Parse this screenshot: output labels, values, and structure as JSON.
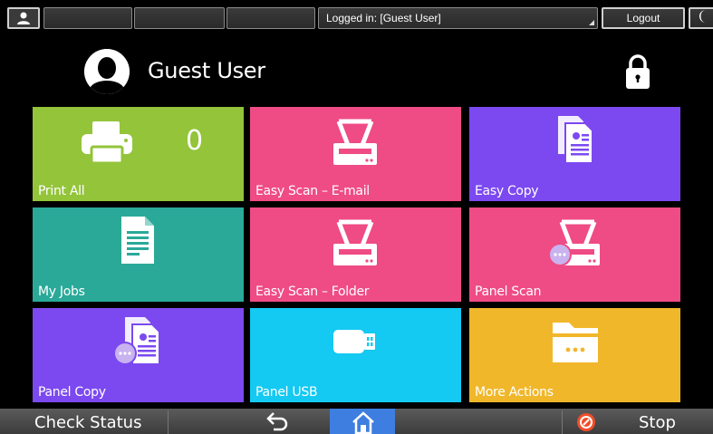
{
  "topbar": {
    "logged_in": "Logged in: [Guest User]",
    "logout_label": "Logout",
    "user_icon": "user-icon",
    "moon_icon": "moon-icon"
  },
  "header": {
    "username": "Guest User",
    "avatar_icon": "user-avatar-icon",
    "lock_icon": "lock-icon"
  },
  "tiles": [
    {
      "label": "Print All",
      "icon": "printer-icon",
      "count": "0",
      "color": "#93c43a"
    },
    {
      "label": "Easy Scan – E-mail",
      "icon": "scanner-icon",
      "color": "#ef4b84"
    },
    {
      "label": "Easy Copy",
      "icon": "copy-document-icon",
      "color": "#7c49f0"
    },
    {
      "label": "My Jobs",
      "icon": "document-icon",
      "color": "#2aa999"
    },
    {
      "label": "Easy Scan – Folder",
      "icon": "scanner-icon",
      "color": "#ef4b84"
    },
    {
      "label": "Panel Scan",
      "icon": "scanner-more-icon",
      "color": "#ef4b84"
    },
    {
      "label": "Panel Copy",
      "icon": "copy-more-icon",
      "color": "#7c49f0"
    },
    {
      "label": "Panel USB",
      "icon": "usb-icon",
      "color": "#14c9f2"
    },
    {
      "label": "More Actions",
      "icon": "folder-icon",
      "color": "#f1b72a"
    }
  ],
  "bottombar": {
    "check_status": "Check Status",
    "back_icon": "back-arrow-icon",
    "home_icon": "home-icon",
    "stop_icon": "stop-icon",
    "stop_label": "Stop",
    "home_color": "#3e7ee0",
    "stop_color": "#f04e2a"
  }
}
